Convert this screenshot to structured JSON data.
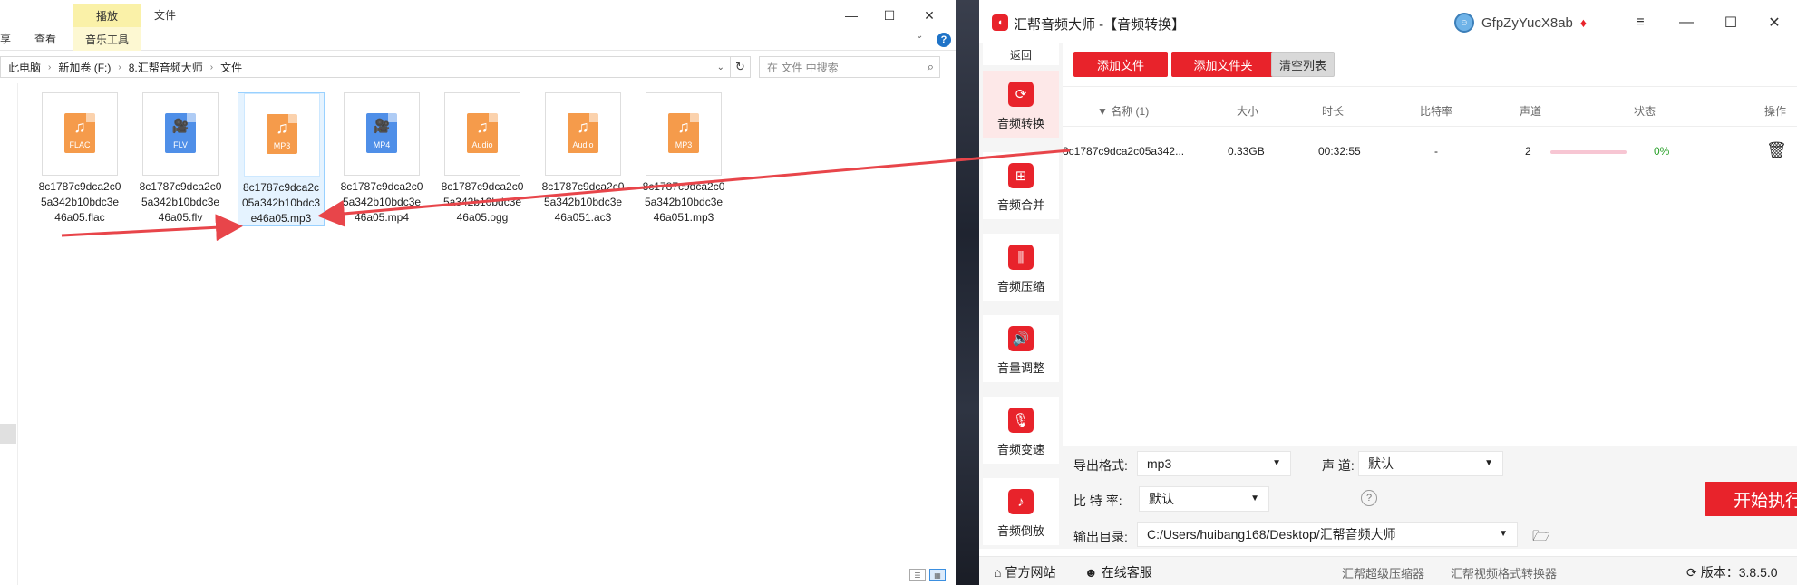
{
  "explorer": {
    "ribbon": {
      "share_tab": "享",
      "view_tab": "查看",
      "manage_context": "播放",
      "music_tools_tab": "音乐工具",
      "file_label": "文件"
    },
    "window": {
      "minimize": "—",
      "maximize": "☐",
      "close": "✕"
    },
    "breadcrumb": [
      "此电脑",
      "新加卷 (F:)",
      "8.汇帮音频大师",
      "文件"
    ],
    "search_placeholder": "在 文件 中搜索",
    "files": [
      {
        "ext": "FLAC",
        "color": "orange",
        "glyph": "♫",
        "name": "8c1787c9dca2c05a342b10bdc3e46a05.flac"
      },
      {
        "ext": "FLV",
        "color": "blue",
        "glyph": "🎥",
        "name": "8c1787c9dca2c05a342b10bdc3e46a05.flv"
      },
      {
        "ext": "MP3",
        "color": "orange",
        "glyph": "♫",
        "name": "8c1787c9dca2c05a342b10bdc3e46a05.mp3",
        "selected": true
      },
      {
        "ext": "MP4",
        "color": "blue",
        "glyph": "🎥",
        "name": "8c1787c9dca2c05a342b10bdc3e46a05.mp4"
      },
      {
        "ext": "Audio",
        "color": "orange",
        "glyph": "♫",
        "name": "8c1787c9dca2c05a342b10bdc3e46a05.ogg"
      },
      {
        "ext": "Audio",
        "color": "orange",
        "glyph": "♫",
        "name": "8c1787c9dca2c05a342b10bdc3e46a051.ac3"
      },
      {
        "ext": "MP3",
        "color": "orange",
        "glyph": "♫",
        "name": "8c1787c9dca2c05a342b10bdc3e46a051.mp3"
      }
    ]
  },
  "app": {
    "title": "汇帮音频大师  -【音频转换】",
    "user_name": "GfpZyYucX8ab",
    "window": {
      "menu": "≡",
      "minimize": "—",
      "maximize": "☐",
      "close": "✕"
    },
    "back_label": "返回",
    "nav": [
      {
        "label": "音频转换",
        "icon": "⟳",
        "active": true
      },
      {
        "label": "音频合并",
        "icon": "⊞"
      },
      {
        "label": "音频压缩",
        "icon": "⫼"
      },
      {
        "label": "音量调整",
        "icon": "🔊"
      },
      {
        "label": "音频变速",
        "icon": "🎙"
      },
      {
        "label": "音频倒放",
        "icon": "♪"
      }
    ],
    "toolbar": {
      "add_file": "添加文件",
      "add_folder": "添加文件夹",
      "clear_list": "清空列表"
    },
    "table": {
      "headers": {
        "name": "▼ 名称 (1)",
        "size": "大小",
        "duration": "时长",
        "bitrate": "比特率",
        "channels": "声道",
        "status": "状态",
        "actions": "操作"
      },
      "rows": [
        {
          "name": "8c1787c9dca2c05a342...",
          "size": "0.33GB",
          "duration": "00:32:55",
          "bitrate": "-",
          "channels": "2",
          "progress": 0,
          "percent": "0%"
        }
      ]
    },
    "settings": {
      "format_label": "导出格式:",
      "format_value": "mp3",
      "channel_label": "声 道:",
      "channel_value": "默认",
      "bitrate_label": "比 特 率:",
      "bitrate_value": "默认",
      "output_label": "输出目录:",
      "output_value": "C:/Users/huibang168/Desktop/汇帮音频大师",
      "start_button": "开始执行"
    },
    "footer": {
      "website": "官方网站",
      "support": "在线客服",
      "link_compressor": "汇帮超级压缩器",
      "link_video_converter": "汇帮视频格式转换器",
      "version": "版本：3.8.5.0"
    }
  },
  "colors": {
    "brand_red": "#e8232b",
    "selection_blue": "#e5f3ff",
    "progress_pink": "#f7c6d3",
    "success_green": "#2aa12a",
    "arrow_red": "#e8454a"
  }
}
